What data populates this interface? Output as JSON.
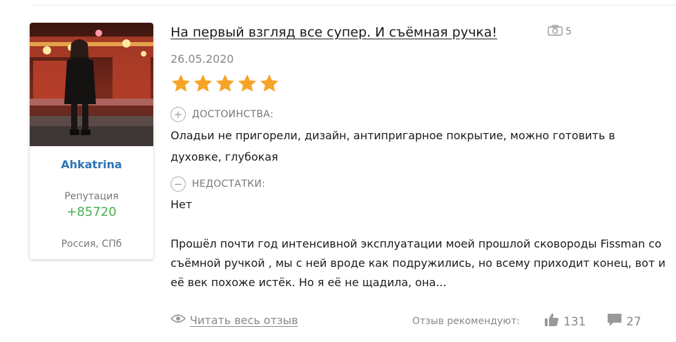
{
  "author": {
    "name": "Ahkatrina",
    "reputation_label": "Репутация",
    "reputation_value": "+85720",
    "location": "Россия, СПб"
  },
  "review": {
    "title": "На первый взгляд все супер. И съёмная ручка!",
    "photo_count": "5",
    "date": "26.05.2020",
    "rating": 5,
    "pros_label": "ДОСТОИНСТВА:",
    "pros_text": "Оладьи не пригорели, дизайн, антипригарное покрытие, можно готовить в духовке, глубокая",
    "cons_label": "НЕДОСТАТКИ:",
    "cons_text": "Нет",
    "body": "Прошёл почти год интенсивной эксплуатации моей прошлой сковороды Fissman со съёмной ручкой , мы с ней вроде как подружились, но всему приходит конец, вот и её век похоже истёк. Но я её не щадила, она..."
  },
  "footer": {
    "read_more": "Читать весь отзыв",
    "recommend_label": "Отзыв рекомендуют:",
    "likes": "131",
    "comments": "27"
  },
  "colors": {
    "star": "#f7a326",
    "author_name": "#2e74b5",
    "reputation": "#4caf50",
    "muted": "#888888"
  },
  "icons": [
    "camera-icon",
    "star-icon",
    "plus-circle-icon",
    "minus-circle-icon",
    "eye-icon",
    "thumbs-up-icon",
    "comment-icon"
  ]
}
